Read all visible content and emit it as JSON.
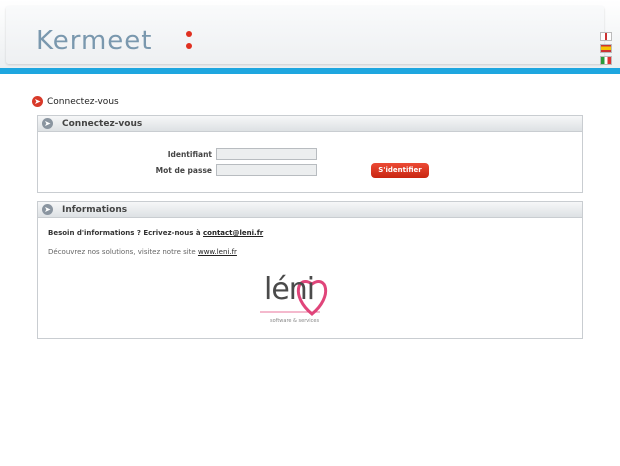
{
  "header": {
    "logo_text": "Kermeet",
    "languages": [
      "en-flag-icon",
      "es-flag-icon",
      "it-flag-icon"
    ]
  },
  "breadcrumb": {
    "label": "Connectez-vous"
  },
  "login_panel": {
    "title": "Connectez-vous",
    "username_label": "Identifiant",
    "password_label": "Mot de passe",
    "username_value": "",
    "password_value": "",
    "submit_label": "S'identifier"
  },
  "info_panel": {
    "title": "Informations",
    "line1_text": "Besoin d'informations ? Ecrivez-nous à ",
    "line1_link": "contact@leni.fr",
    "line2_text": "Découvrez nos solutions, visitez notre site ",
    "line2_link": "www.leni.fr",
    "logo_text": "léni",
    "logo_subtitle": "software & services"
  },
  "colors": {
    "accent_blue": "#1ea6df",
    "button_red": "#d9341f",
    "logo_grey": "#7a98ae"
  }
}
